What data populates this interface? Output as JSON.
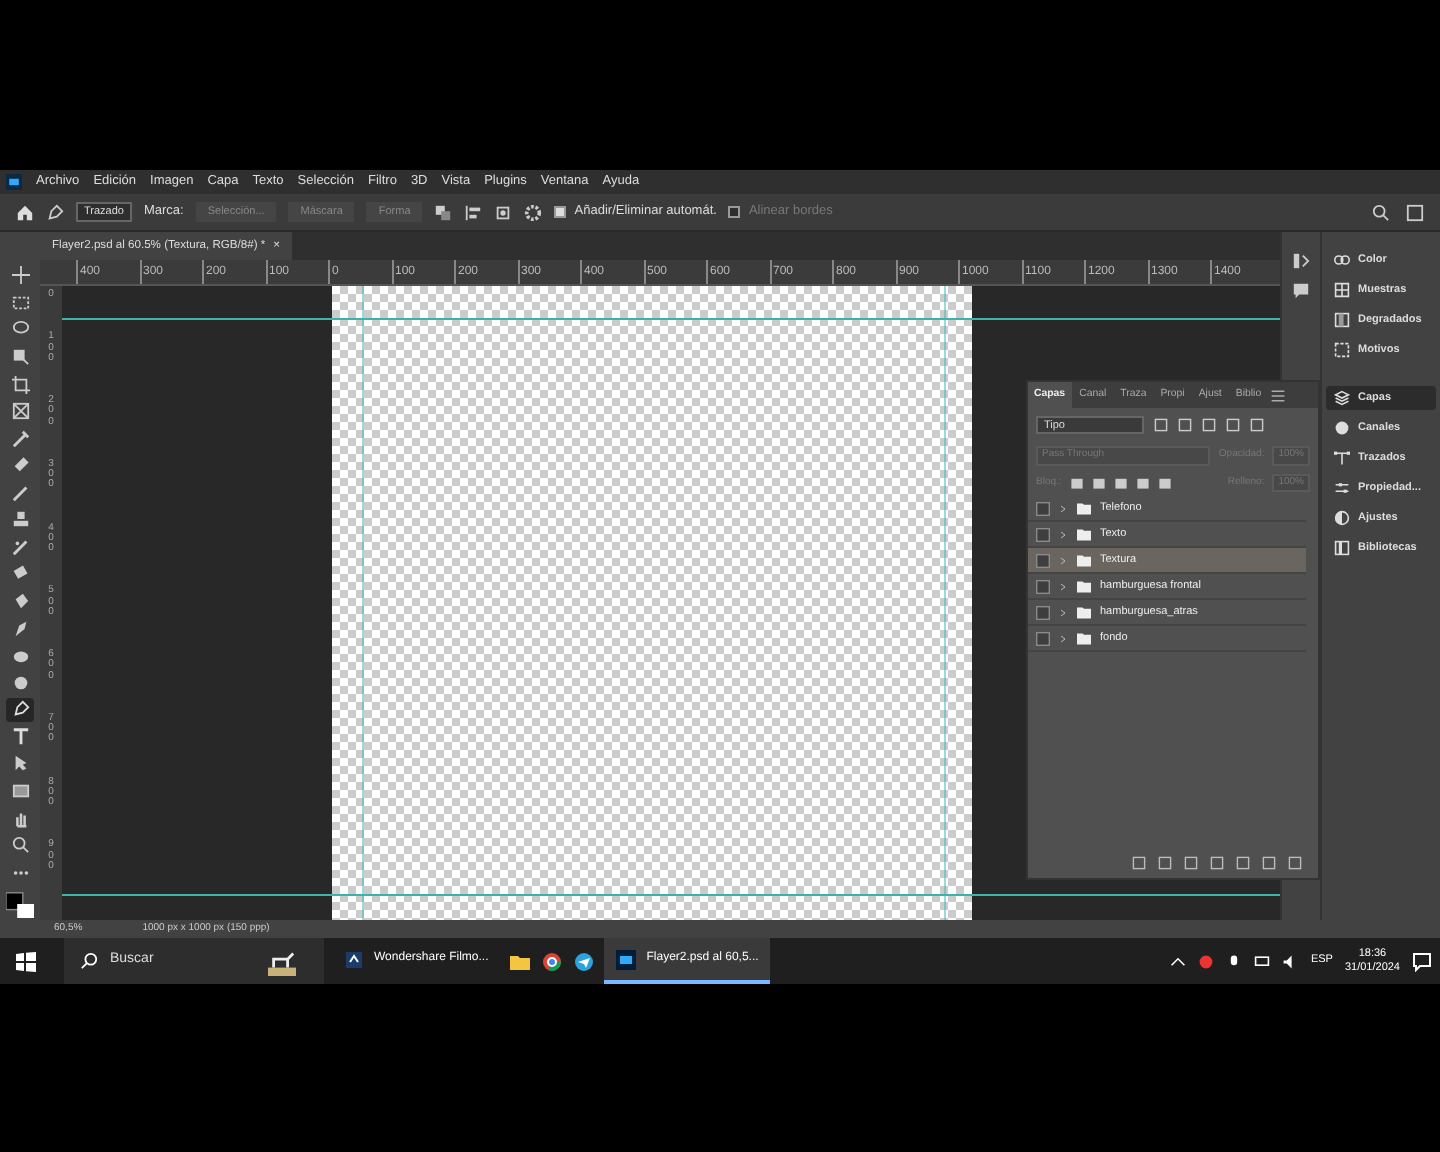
{
  "menu": {
    "items": [
      "Archivo",
      "Edición",
      "Imagen",
      "Capa",
      "Texto",
      "Selección",
      "Filtro",
      "3D",
      "Vista",
      "Plugins",
      "Ventana",
      "Ayuda"
    ]
  },
  "options_bar": {
    "mode": "Trazado",
    "make_label": "Marca:",
    "buttons": [
      "Selección...",
      "Máscara",
      "Forma"
    ],
    "checkboxes": [
      {
        "label": "Añadir/Eliminar automát.",
        "checked": true
      },
      {
        "label": "Alinear bordes",
        "checked": false
      }
    ]
  },
  "document_tab": {
    "title": "Flayer2.psd al 60.5% (Textura, RGB/8#) *",
    "close": "×"
  },
  "ruler_h": [
    "400",
    "300",
    "200",
    "100",
    "0",
    "100",
    "200",
    "300",
    "400",
    "500",
    "600",
    "700",
    "800",
    "900",
    "1000",
    "1100",
    "1200",
    "1300",
    "1400"
  ],
  "ruler_v": [
    "0",
    "100",
    "200",
    "300",
    "400",
    "500",
    "600",
    "700",
    "800",
    "900"
  ],
  "toolbar": {
    "tools": [
      {
        "selected": false
      },
      {
        "selected": false
      },
      {
        "selected": false
      },
      {
        "selected": false
      },
      {
        "selected": false
      },
      {
        "selected": false
      },
      {
        "selected": false
      },
      {
        "selected": false
      },
      {
        "selected": false
      },
      {
        "selected": false
      },
      {
        "selected": false
      },
      {
        "selected": false
      },
      {
        "selected": false
      },
      {
        "selected": false
      },
      {
        "selected": false
      },
      {
        "selected": false
      },
      {
        "selected": true
      },
      {
        "selected": false
      },
      {
        "selected": false
      },
      {
        "selected": false
      },
      {
        "selected": false
      },
      {
        "selected": false
      },
      {
        "selected": false
      }
    ]
  },
  "layers_panel": {
    "tabs": [
      {
        "label": "Capas",
        "selected": true
      },
      {
        "label": "Canal",
        "selected": false
      },
      {
        "label": "Traza",
        "selected": false
      },
      {
        "label": "Propi",
        "selected": false
      },
      {
        "label": "Ajust",
        "selected": false
      },
      {
        "label": "Biblio",
        "selected": false
      }
    ],
    "filter": "Tipo",
    "blend_mode": "Pass Through",
    "opacity_label": "Opacidad:",
    "opacity": "100%",
    "lock_label": "Bloq.:",
    "fill_label": "Relleno:",
    "fill": "100%",
    "layers": [
      {
        "name": "Telefono",
        "selected": false
      },
      {
        "name": "Texto",
        "selected": false
      },
      {
        "name": "Textura",
        "selected": true
      },
      {
        "name": "hamburguesa frontal",
        "selected": false
      },
      {
        "name": "hamburguesa_atras",
        "selected": false
      },
      {
        "name": "fondo",
        "selected": false
      }
    ]
  },
  "side_panels": {
    "group_1": [
      {
        "label": "Color",
        "selected": false
      },
      {
        "label": "Muestras",
        "selected": false
      },
      {
        "label": "Degradados",
        "selected": false
      },
      {
        "label": "Motivos",
        "selected": false
      }
    ],
    "group_2": [
      {
        "label": "Capas",
        "selected": true
      },
      {
        "label": "Canales",
        "selected": false
      },
      {
        "label": "Trazados",
        "selected": false
      },
      {
        "label": "Propiedad...",
        "selected": false
      },
      {
        "label": "Ajustes",
        "selected": false
      },
      {
        "label": "Bibliotecas",
        "selected": false
      }
    ]
  },
  "status_bar": {
    "zoom": "60,5%",
    "info": "1000 px x 1000 px (150 ppp)"
  },
  "taskbar": {
    "search": "Buscar",
    "apps": [
      {
        "label": "Wondershare Filmo...",
        "active": false
      },
      {
        "label": "Flayer2.psd al 60,5...",
        "active": true
      }
    ],
    "language": "ESP",
    "time": "18:36",
    "date": "31/01/2024"
  }
}
